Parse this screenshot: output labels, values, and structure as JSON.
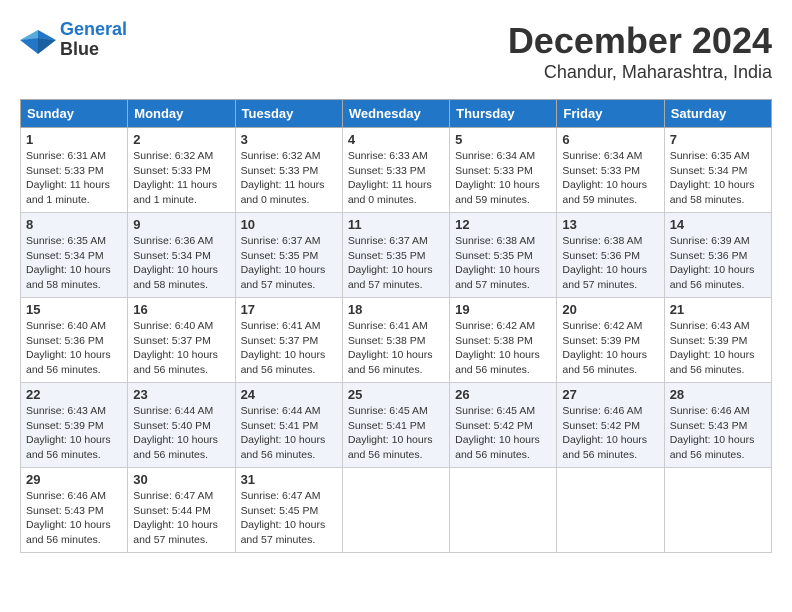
{
  "logo": {
    "line1": "General",
    "line2": "Blue"
  },
  "title": "December 2024",
  "location": "Chandur, Maharashtra, India",
  "headers": [
    "Sunday",
    "Monday",
    "Tuesday",
    "Wednesday",
    "Thursday",
    "Friday",
    "Saturday"
  ],
  "weeks": [
    [
      {
        "day": "1",
        "sunrise": "6:31 AM",
        "sunset": "5:33 PM",
        "daylight": "11 hours and 1 minute."
      },
      {
        "day": "2",
        "sunrise": "6:32 AM",
        "sunset": "5:33 PM",
        "daylight": "11 hours and 1 minute."
      },
      {
        "day": "3",
        "sunrise": "6:32 AM",
        "sunset": "5:33 PM",
        "daylight": "11 hours and 0 minutes."
      },
      {
        "day": "4",
        "sunrise": "6:33 AM",
        "sunset": "5:33 PM",
        "daylight": "11 hours and 0 minutes."
      },
      {
        "day": "5",
        "sunrise": "6:34 AM",
        "sunset": "5:33 PM",
        "daylight": "10 hours and 59 minutes."
      },
      {
        "day": "6",
        "sunrise": "6:34 AM",
        "sunset": "5:33 PM",
        "daylight": "10 hours and 59 minutes."
      },
      {
        "day": "7",
        "sunrise": "6:35 AM",
        "sunset": "5:34 PM",
        "daylight": "10 hours and 58 minutes."
      }
    ],
    [
      {
        "day": "8",
        "sunrise": "6:35 AM",
        "sunset": "5:34 PM",
        "daylight": "10 hours and 58 minutes."
      },
      {
        "day": "9",
        "sunrise": "6:36 AM",
        "sunset": "5:34 PM",
        "daylight": "10 hours and 58 minutes."
      },
      {
        "day": "10",
        "sunrise": "6:37 AM",
        "sunset": "5:35 PM",
        "daylight": "10 hours and 57 minutes."
      },
      {
        "day": "11",
        "sunrise": "6:37 AM",
        "sunset": "5:35 PM",
        "daylight": "10 hours and 57 minutes."
      },
      {
        "day": "12",
        "sunrise": "6:38 AM",
        "sunset": "5:35 PM",
        "daylight": "10 hours and 57 minutes."
      },
      {
        "day": "13",
        "sunrise": "6:38 AM",
        "sunset": "5:36 PM",
        "daylight": "10 hours and 57 minutes."
      },
      {
        "day": "14",
        "sunrise": "6:39 AM",
        "sunset": "5:36 PM",
        "daylight": "10 hours and 56 minutes."
      }
    ],
    [
      {
        "day": "15",
        "sunrise": "6:40 AM",
        "sunset": "5:36 PM",
        "daylight": "10 hours and 56 minutes."
      },
      {
        "day": "16",
        "sunrise": "6:40 AM",
        "sunset": "5:37 PM",
        "daylight": "10 hours and 56 minutes."
      },
      {
        "day": "17",
        "sunrise": "6:41 AM",
        "sunset": "5:37 PM",
        "daylight": "10 hours and 56 minutes."
      },
      {
        "day": "18",
        "sunrise": "6:41 AM",
        "sunset": "5:38 PM",
        "daylight": "10 hours and 56 minutes."
      },
      {
        "day": "19",
        "sunrise": "6:42 AM",
        "sunset": "5:38 PM",
        "daylight": "10 hours and 56 minutes."
      },
      {
        "day": "20",
        "sunrise": "6:42 AM",
        "sunset": "5:39 PM",
        "daylight": "10 hours and 56 minutes."
      },
      {
        "day": "21",
        "sunrise": "6:43 AM",
        "sunset": "5:39 PM",
        "daylight": "10 hours and 56 minutes."
      }
    ],
    [
      {
        "day": "22",
        "sunrise": "6:43 AM",
        "sunset": "5:39 PM",
        "daylight": "10 hours and 56 minutes."
      },
      {
        "day": "23",
        "sunrise": "6:44 AM",
        "sunset": "5:40 PM",
        "daylight": "10 hours and 56 minutes."
      },
      {
        "day": "24",
        "sunrise": "6:44 AM",
        "sunset": "5:41 PM",
        "daylight": "10 hours and 56 minutes."
      },
      {
        "day": "25",
        "sunrise": "6:45 AM",
        "sunset": "5:41 PM",
        "daylight": "10 hours and 56 minutes."
      },
      {
        "day": "26",
        "sunrise": "6:45 AM",
        "sunset": "5:42 PM",
        "daylight": "10 hours and 56 minutes."
      },
      {
        "day": "27",
        "sunrise": "6:46 AM",
        "sunset": "5:42 PM",
        "daylight": "10 hours and 56 minutes."
      },
      {
        "day": "28",
        "sunrise": "6:46 AM",
        "sunset": "5:43 PM",
        "daylight": "10 hours and 56 minutes."
      }
    ],
    [
      {
        "day": "29",
        "sunrise": "6:46 AM",
        "sunset": "5:43 PM",
        "daylight": "10 hours and 56 minutes."
      },
      {
        "day": "30",
        "sunrise": "6:47 AM",
        "sunset": "5:44 PM",
        "daylight": "10 hours and 57 minutes."
      },
      {
        "day": "31",
        "sunrise": "6:47 AM",
        "sunset": "5:45 PM",
        "daylight": "10 hours and 57 minutes."
      },
      null,
      null,
      null,
      null
    ]
  ]
}
